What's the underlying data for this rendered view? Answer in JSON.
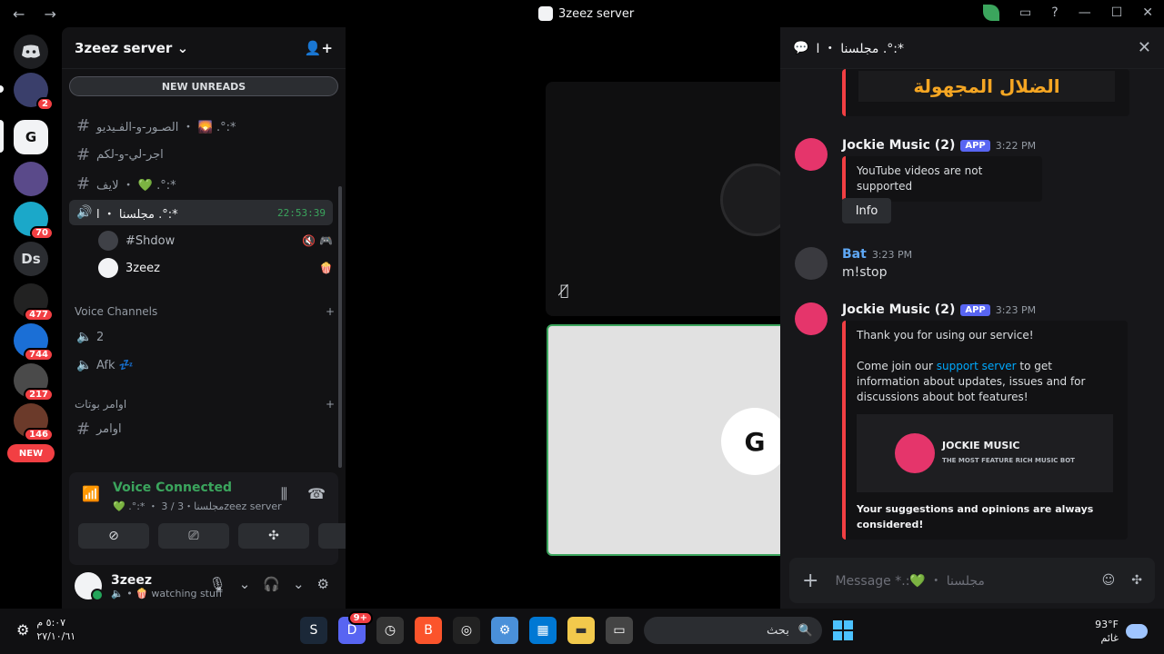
{
  "titlebar": {
    "back": "←",
    "forward": "→",
    "title": "3zeez server",
    "help": "?",
    "minimize": "—",
    "maximize": "☐",
    "close": "✕"
  },
  "guilds": {
    "home_icon": "discord-logo-icon",
    "badges": [
      "2",
      "70",
      "477",
      "744",
      "217",
      "146"
    ],
    "ds_label": "Ds",
    "new_pill": "NEW"
  },
  "server": {
    "name": "3zeez server",
    "chevron": "⌄",
    "new_unreads": "NEW UNREADS"
  },
  "channels": [
    {
      "name": "الصـور-و-الفـيديو ・ 🌄 .°:*",
      "type": "text"
    },
    {
      "name": "اجر-لي-و-لكم",
      "type": "text"
    },
    {
      "name": "لايف ・ 💚 .°:*",
      "type": "text"
    },
    {
      "name": "مجلسنا ・ ا .°:*",
      "type": "voice",
      "time": "22:53:39"
    }
  ],
  "voice_users": [
    {
      "name": "#Shdow",
      "icons": "🔇 🎮"
    },
    {
      "name": "3zeez",
      "icons": "🍿"
    }
  ],
  "categories": {
    "voice": "Voice Channels",
    "bots": "اوامر بوتات"
  },
  "voice_channels": [
    {
      "name": "2"
    },
    {
      "name": "Afk 💤"
    }
  ],
  "bot_channels": [
    {
      "name": "اوامر"
    }
  ],
  "voice_panel": {
    "title": "Voice Connected",
    "subtitle": "💚 .°:* ・ 3 / مجلسنا・3zeez server"
  },
  "user": {
    "name": "3zeez",
    "status": "🔈 • 🍿 watching stuff"
  },
  "thread": {
    "title": "مجلسنا ・ ا .°:*",
    "banner_text": "الضلال المجهولة",
    "messages": [
      {
        "author": "Jockie Music (2)",
        "tag": "APP",
        "time": "3:22 PM",
        "text": "YouTube videos are not supported",
        "button": "Info"
      },
      {
        "author": "Bat",
        "time": "3:23 PM",
        "text": "m!stop"
      },
      {
        "author": "Jockie Music (2)",
        "tag": "APP",
        "time": "3:23 PM",
        "line1": "Thank you for using our service!",
        "line2_pre": "Come join our ",
        "line2_link": "support server",
        "line2_post": " to get information about updates, issues and for discussions about bot features!",
        "img_title": "JOCKIE MUSIC",
        "img_sub": "THE MOST FEATURE RICH MUSIC BOT",
        "footer": "Your suggestions and opinions are always considered!"
      }
    ],
    "composer_placeholder": "Message *.:💚 ・ مجلسنا"
  },
  "taskbar": {
    "time": "٥:٠٧ م",
    "date": "٢٧/١٠/٦١",
    "search_label": "بحث",
    "discord_badge": "9+",
    "weather_temp": "93°F",
    "weather_text": "غائم"
  }
}
